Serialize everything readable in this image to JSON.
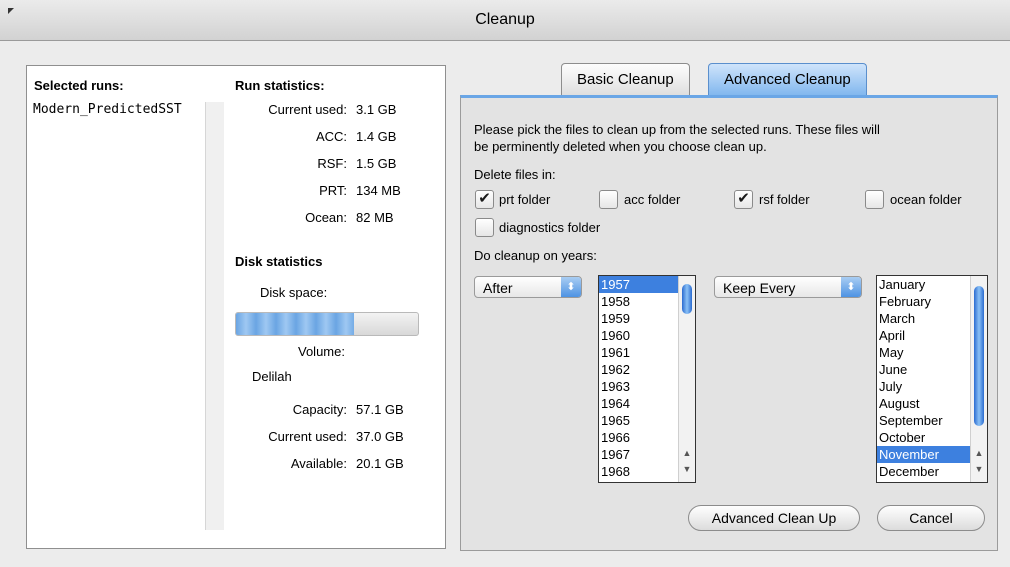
{
  "window": {
    "title": "Cleanup"
  },
  "left": {
    "selected_runs_label": "Selected runs:",
    "runs": [
      "Modern_PredictedSST"
    ],
    "run_stats_label": "Run statistics:",
    "run_stats": [
      {
        "label": "Current used:",
        "value": "3.1 GB"
      },
      {
        "label": "ACC:",
        "value": "1.4 GB"
      },
      {
        "label": "RSF:",
        "value": "1.5 GB"
      },
      {
        "label": "PRT:",
        "value": "134 MB"
      },
      {
        "label": "Ocean:",
        "value": "82 MB"
      }
    ],
    "disk_stats_label": "Disk statistics",
    "disk_space_label": "Disk space:",
    "disk_used_fraction": 0.65,
    "volume_label": "Volume:",
    "volume_name": "Delilah",
    "disk_stats": [
      {
        "label": "Capacity:",
        "value": "57.1 GB"
      },
      {
        "label": "Current used:",
        "value": "37.0 GB"
      },
      {
        "label": "Available:",
        "value": "20.1 GB"
      }
    ]
  },
  "tabs": {
    "basic": "Basic Cleanup",
    "advanced": "Advanced Cleanup",
    "active": "advanced"
  },
  "advanced": {
    "instructions_line1": "Please pick the files to clean up from the selected runs. These files will",
    "instructions_line2": "be perminently deleted when you choose clean up.",
    "delete_in_label": "Delete files in:",
    "folders": [
      {
        "label": "prt folder",
        "checked": true
      },
      {
        "label": "acc folder",
        "checked": false
      },
      {
        "label": "rsf folder",
        "checked": true
      },
      {
        "label": "ocean folder",
        "checked": false
      },
      {
        "label": "diagnostics folder",
        "checked": false
      }
    ],
    "years_label": "Do cleanup on years:",
    "years_mode": "After",
    "years": [
      "1957",
      "1958",
      "1959",
      "1960",
      "1961",
      "1962",
      "1963",
      "1964",
      "1965",
      "1966",
      "1967",
      "1968"
    ],
    "years_selected": "1957",
    "keep_mode": "Keep Every",
    "months": [
      "January",
      "February",
      "March",
      "April",
      "May",
      "June",
      "July",
      "August",
      "September",
      "October",
      "November",
      "December"
    ],
    "months_selected": "November",
    "primary_button": "Advanced Clean Up",
    "cancel_button": "Cancel"
  }
}
